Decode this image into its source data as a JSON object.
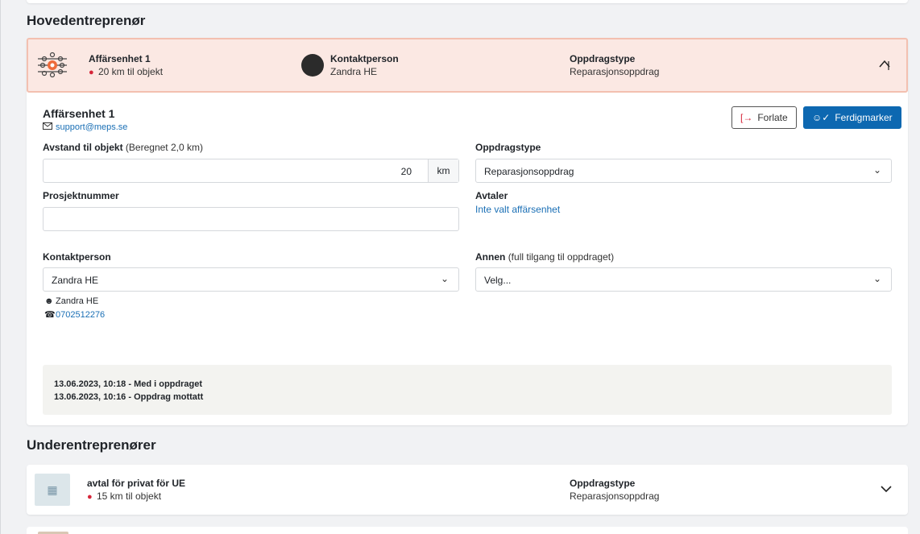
{
  "main_section_title": "Hovedentreprenør",
  "sub_section_title": "Underentreprenører",
  "main_card": {
    "unit_name": "Affärsenhet 1",
    "distance": "20 km til objekt",
    "contact_label": "Kontaktperson",
    "contact_name": "Zandra HE",
    "assignment_type_label": "Oppdragstype",
    "assignment_type_value": "Reparasjonsoppdrag",
    "detail": {
      "unit_name": "Affärsenhet 1",
      "email": "support@meps.se",
      "leave_button": "Forlate",
      "complete_button": "Ferdigmarker",
      "distance_label": "Avstand til objekt",
      "distance_note": "(Beregnet 2,0 km)",
      "distance_value": "20",
      "distance_unit": "km",
      "assignment_type_label": "Oppdragstype",
      "assignment_type_value": "Reparasjonsoppdrag",
      "project_number_label": "Prosjektnummer",
      "project_number_value": "",
      "agreements_label": "Avtaler",
      "agreements_value": "Inte valt affärsenhet",
      "contact_label": "Kontaktperson",
      "contact_value": "Zandra HE",
      "other_label": "Annen",
      "other_note": "(full tilgang til oppdraget)",
      "other_value": "Velg...",
      "contact_person_name": "Zandra HE",
      "contact_person_phone": "0702512276",
      "history": [
        "13.06.2023, 10:18 - Med i oppdraget",
        "13.06.2023, 10:16 - Oppdrag mottatt"
      ]
    }
  },
  "ue_card": {
    "name": "avtal för privat för UE",
    "distance": "15 km til objekt",
    "assignment_type_label": "Oppdragstype",
    "assignment_type_value": "Reparasjonsoppdrag"
  },
  "colors": {
    "primary": "#0d68b1",
    "header_bg": "#fbe8e3",
    "header_border": "#f3c0b0",
    "pin": "#d6263a",
    "link": "#1a6fb5"
  }
}
